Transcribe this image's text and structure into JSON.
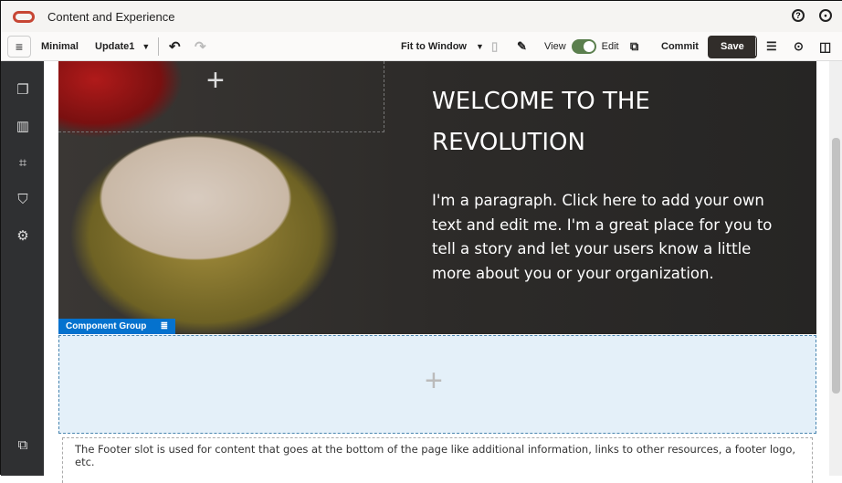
{
  "app": {
    "title": "Content and Experience"
  },
  "toolbar": {
    "site": "Minimal",
    "update": "Update1",
    "fit": "Fit to Window",
    "view": "View",
    "edit": "Edit",
    "commit": "Commit",
    "save": "Save",
    "edit_mode_on": true
  },
  "hero": {
    "heading": "WELCOME TO THE REVOLUTION",
    "paragraph": "I'm a paragraph. Click here to add your own text and edit me. I'm a great place for you to tell a story and let your users know a little more about you or your organization."
  },
  "component_group": {
    "label": "Component Group"
  },
  "footer": {
    "text": "The Footer slot is used for content that goes at the bottom of the page like additional information, links to other resources, a footer logo, etc."
  }
}
